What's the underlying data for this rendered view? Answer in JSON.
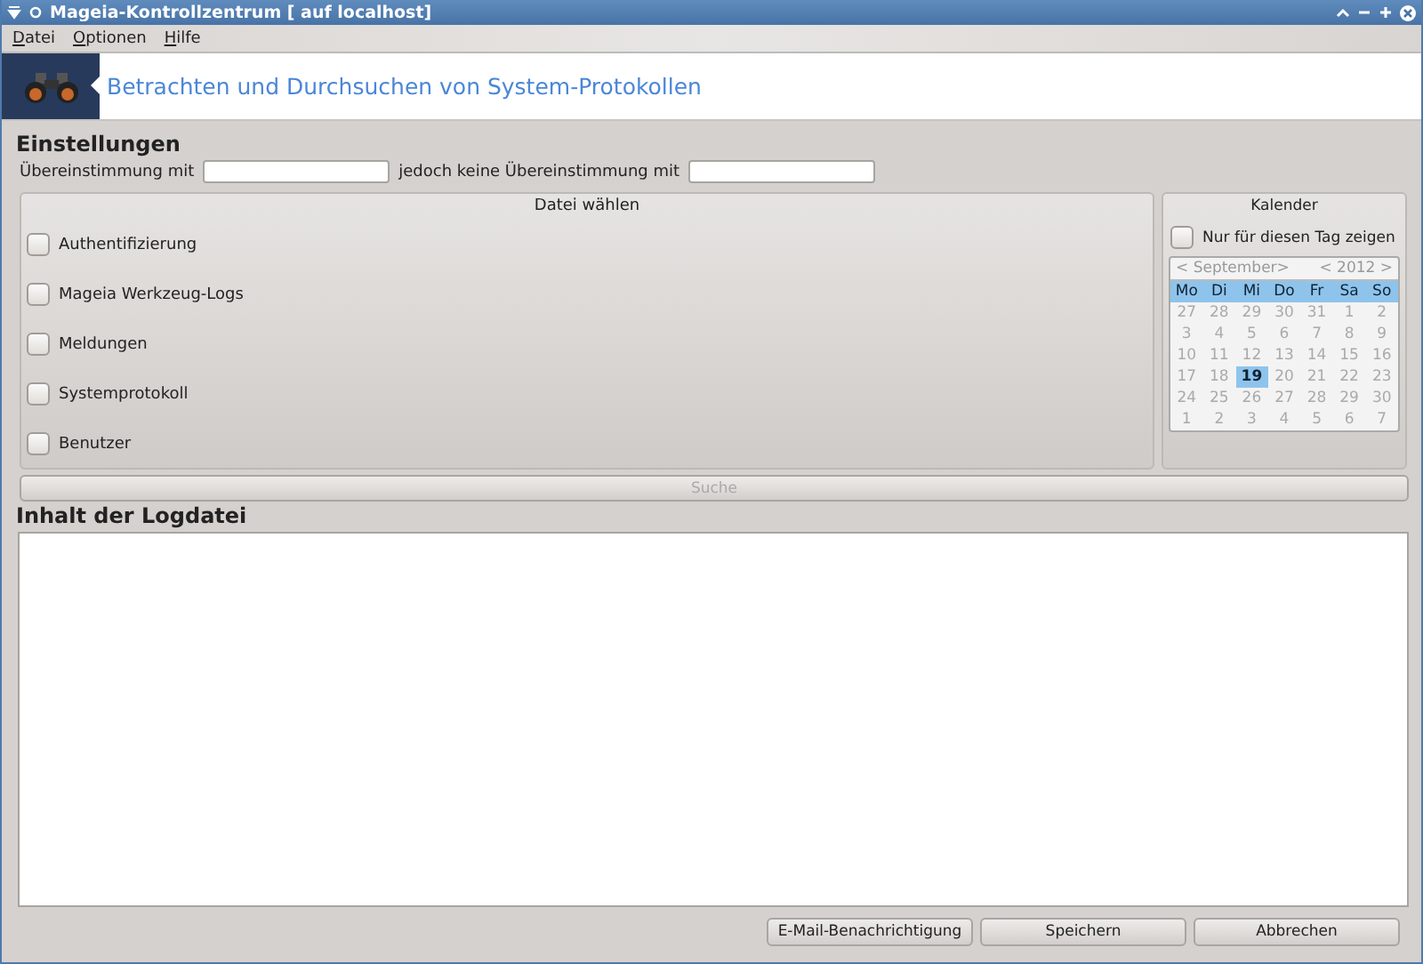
{
  "window": {
    "title": "Mageia-Kontrollzentrum  [ auf localhost]"
  },
  "menu": [
    {
      "mnemonic": "D",
      "rest": "atei"
    },
    {
      "mnemonic": "O",
      "rest": "ptionen"
    },
    {
      "mnemonic": "H",
      "rest": "ilfe"
    }
  ],
  "banner": {
    "title": "Betrachten und Durchsuchen von System-Protokollen"
  },
  "settings": {
    "heading": "Einstellungen",
    "match_label": "Übereinstimmung mit",
    "nomatch_label": "jedoch keine Übereinstimmung mit"
  },
  "files": {
    "title": "Datei wählen",
    "items": [
      {
        "label": "Authentifizierung",
        "checked": false
      },
      {
        "label": "Mageia Werkzeug-Logs",
        "checked": false
      },
      {
        "label": "Meldungen",
        "checked": false
      },
      {
        "label": "Systemprotokoll",
        "checked": false
      },
      {
        "label": "Benutzer",
        "checked": false
      }
    ]
  },
  "calendar": {
    "title": "Kalender",
    "only_day_label": "Nur für diesen Tag zeigen",
    "only_day_checked": false,
    "disabled": true,
    "month": "September",
    "year": "2012",
    "prev": "<",
    "next": ">",
    "weekdays": [
      "Mo",
      "Di",
      "Mi",
      "Do",
      "Fr",
      "Sa",
      "So"
    ],
    "weeks": [
      [
        {
          "day": "27",
          "selected": false
        },
        {
          "day": "28",
          "selected": false
        },
        {
          "day": "29",
          "selected": false
        },
        {
          "day": "30",
          "selected": false
        },
        {
          "day": "31",
          "selected": false
        },
        {
          "day": "1",
          "selected": false
        },
        {
          "day": "2",
          "selected": false
        }
      ],
      [
        {
          "day": "3",
          "selected": false
        },
        {
          "day": "4",
          "selected": false
        },
        {
          "day": "5",
          "selected": false
        },
        {
          "day": "6",
          "selected": false
        },
        {
          "day": "7",
          "selected": false
        },
        {
          "day": "8",
          "selected": false
        },
        {
          "day": "9",
          "selected": false
        }
      ],
      [
        {
          "day": "10",
          "selected": false
        },
        {
          "day": "11",
          "selected": false
        },
        {
          "day": "12",
          "selected": false
        },
        {
          "day": "13",
          "selected": false
        },
        {
          "day": "14",
          "selected": false
        },
        {
          "day": "15",
          "selected": false
        },
        {
          "day": "16",
          "selected": false
        }
      ],
      [
        {
          "day": "17",
          "selected": false
        },
        {
          "day": "18",
          "selected": false
        },
        {
          "day": "19",
          "selected": true
        },
        {
          "day": "20",
          "selected": false
        },
        {
          "day": "21",
          "selected": false
        },
        {
          "day": "22",
          "selected": false
        },
        {
          "day": "23",
          "selected": false
        }
      ],
      [
        {
          "day": "24",
          "selected": false
        },
        {
          "day": "25",
          "selected": false
        },
        {
          "day": "26",
          "selected": false
        },
        {
          "day": "27",
          "selected": false
        },
        {
          "day": "28",
          "selected": false
        },
        {
          "day": "29",
          "selected": false
        },
        {
          "day": "30",
          "selected": false
        }
      ],
      [
        {
          "day": "1",
          "selected": false
        },
        {
          "day": "2",
          "selected": false
        },
        {
          "day": "3",
          "selected": false
        },
        {
          "day": "4",
          "selected": false
        },
        {
          "day": "5",
          "selected": false
        },
        {
          "day": "6",
          "selected": false
        },
        {
          "day": "7",
          "selected": false
        }
      ]
    ]
  },
  "search_button": {
    "label": "Suche",
    "disabled": true
  },
  "log": {
    "heading": "Inhalt der Logdatei"
  },
  "buttons": [
    "E-Mail-Benachrichtigung",
    "Speichern",
    "Abbrechen"
  ]
}
